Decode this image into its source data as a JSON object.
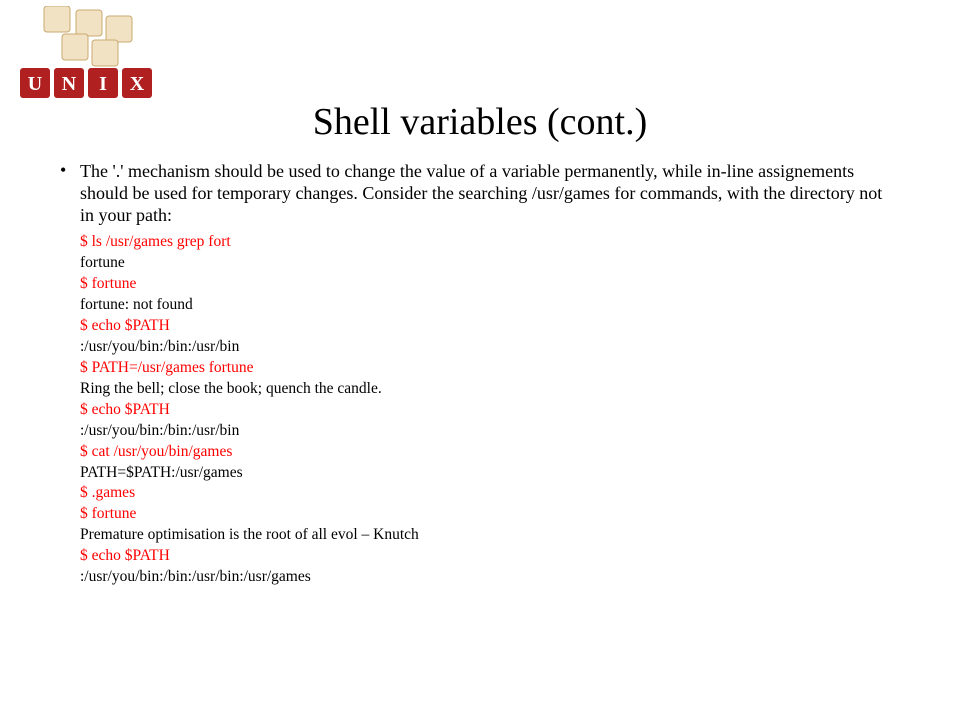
{
  "title": "Shell variables (cont.)",
  "bullet_glyph": "•",
  "intro": "The '.' mechanism should be used to change the value of a variable permanently, while in-line assignements should be used for temporary changes. Consider the searching /usr/games for commands, with the directory not in your path:",
  "code_lines": [
    {
      "color": "red",
      "text": "$ ls /usr/games  grep fort"
    },
    {
      "color": "blk",
      "text": "fortune"
    },
    {
      "color": "red",
      "text": "$ fortune"
    },
    {
      "color": "blk",
      "text": "fortune: not found"
    },
    {
      "color": "red",
      "text": "$ echo $PATH"
    },
    {
      "color": "blk",
      "text": ":/usr/you/bin:/bin:/usr/bin"
    },
    {
      "color": "red",
      "text": "$ PATH=/usr/games fortune"
    },
    {
      "color": "blk",
      "text": "Ring the bell; close the book; quench the candle."
    },
    {
      "color": "red",
      "text": "$ echo $PATH"
    },
    {
      "color": "blk",
      "text": ":/usr/you/bin:/bin:/usr/bin"
    },
    {
      "color": "red",
      "text": "$ cat /usr/you/bin/games"
    },
    {
      "color": "blk",
      "text": "PATH=$PATH:/usr/games"
    },
    {
      "color": "red",
      "text": "$ .games"
    },
    {
      "color": "red",
      "text": "$ fortune"
    },
    {
      "color": "blk",
      "text": "Premature optimisation is the root of all evol – Knutch"
    },
    {
      "color": "red",
      "text": "$ echo $PATH"
    },
    {
      "color": "blk",
      "text": ":/usr/you/bin:/bin:/usr/bin:/usr/games"
    }
  ],
  "logo_letters": [
    "U",
    "N",
    "I",
    "X"
  ]
}
